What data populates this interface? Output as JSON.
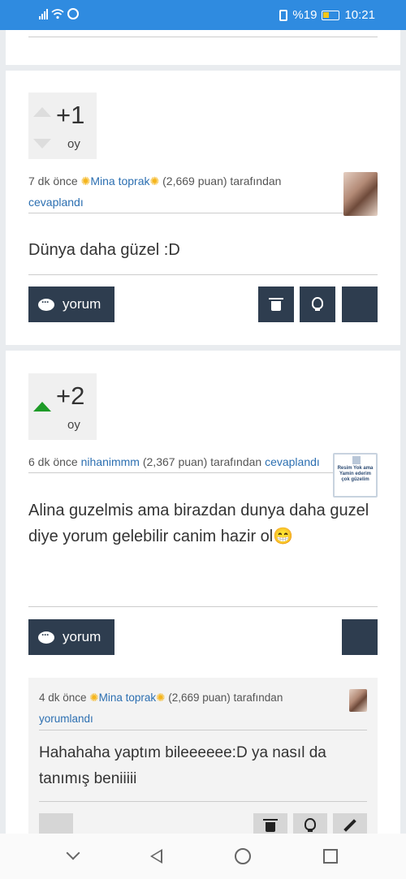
{
  "status": {
    "battery": "%19",
    "time": "10:21"
  },
  "answer1": {
    "votes": "+1",
    "vote_label": "oy",
    "meta_prefix": "7 dk önce ",
    "user": "Mina toprak",
    "star": "✺",
    "points": " (2,669 puan) tarafından",
    "action": "cevaplandı",
    "content": "Dünya daha güzel :D",
    "comment_label": "yorum"
  },
  "answer2": {
    "votes": "+2",
    "vote_label": "oy",
    "meta_prefix": "6 dk önce ",
    "user": "nihanimmm",
    "points": " (2,367 puan) tarafından ",
    "action": "cevaplandı",
    "content": "Alina guzelmis ama birazdan dunya daha guzel diye yorum gelebilir canim hazir ol😁",
    "avatar_text": "Resim Yok ama Yamin ederim çok güzelim",
    "comment_label": "yorum"
  },
  "comment1": {
    "meta_prefix": "4 dk önce ",
    "user": "Mina toprak",
    "star": "✺",
    "points": " (2,669 puan) tarafından",
    "action": "yorumlandı",
    "content": "Hahahaha yaptım bileeeeee:D ya nasıl da tanımış beniiiii"
  }
}
